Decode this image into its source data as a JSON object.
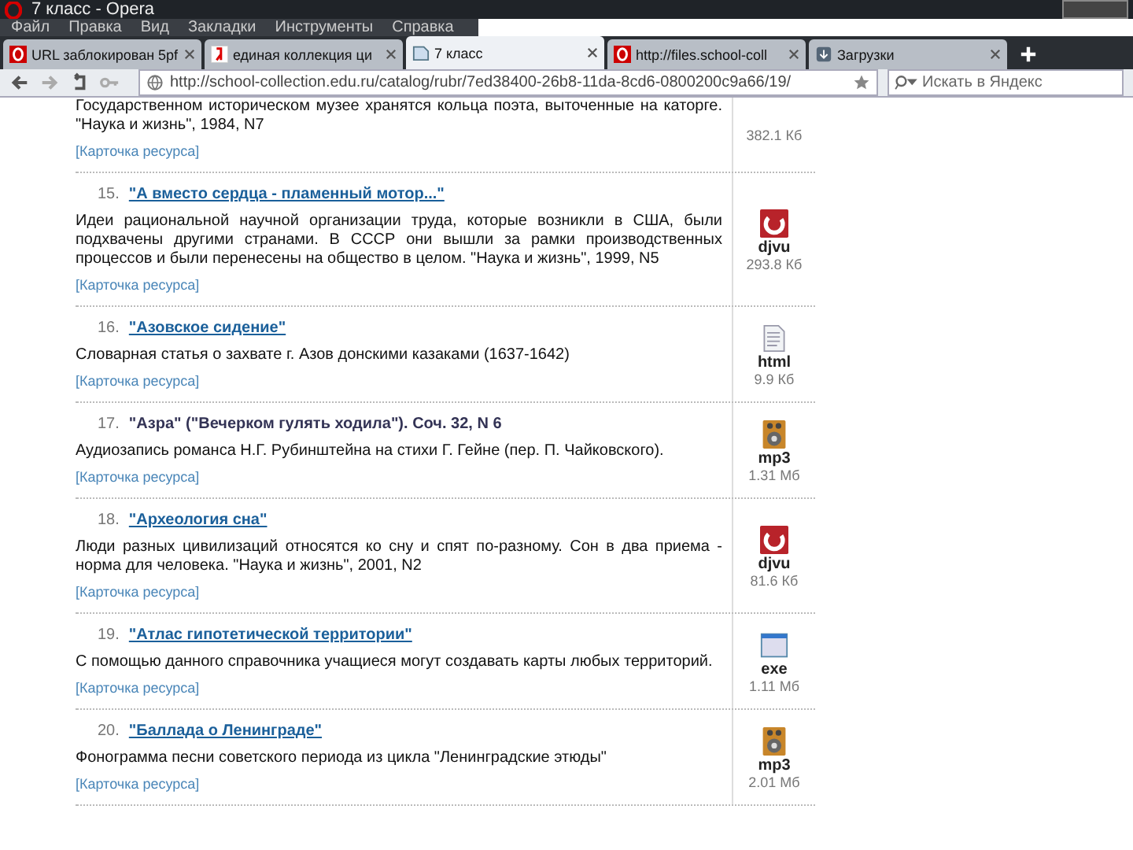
{
  "window": {
    "title": "7 класс - Opera"
  },
  "menu": [
    "Файл",
    "Правка",
    "Вид",
    "Закладки",
    "Инструменты",
    "Справка"
  ],
  "tabs": [
    {
      "label": "URL заблокирован 5pf",
      "kind": "opera",
      "selected": false
    },
    {
      "label": "единая коллекция ци",
      "kind": "yandex",
      "selected": false
    },
    {
      "label": "7 класс",
      "kind": "page",
      "selected": true
    },
    {
      "label": "http://files.school-coll",
      "kind": "opera",
      "selected": false
    },
    {
      "label": "Загрузки",
      "kind": "download",
      "selected": false
    }
  ],
  "address": {
    "value": "http://school-collection.edu.ru/catalog/rubr/7ed38400-26b8-11da-8cd6-0800200c9a66/19/"
  },
  "search": {
    "placeholder": "Искать в Яндекс"
  },
  "partial_item": {
    "description": "Государственном историческом музее хранятся кольца поэта, выточенные на каторге. \"Наука и жизнь\", 1984, N7",
    "card_link": "[Карточка ресурса]",
    "size": "382.1 Кб"
  },
  "items": [
    {
      "number": "15.",
      "title": "\"А вместо сердца - пламенный мотор...\"",
      "visited": false,
      "description": "Идеи рациональной научной организации труда, которые возникли в США, были подхвачены другими странами. В СССР они вышли за рамки производственных процессов и были перенесены на общество в целом. \"Наука и жизнь\", 1999, N5",
      "card_link": "[Карточка ресурса]",
      "kind": "djvu",
      "format": "djvu",
      "size": "293.8 Кб"
    },
    {
      "number": "16.",
      "title": "\"Азовское сидение\"",
      "visited": false,
      "description": "Словарная статья о захвате г. Азов донскими казаками (1637-1642)",
      "card_link": "[Карточка ресурса]",
      "kind": "html",
      "format": "html",
      "size": "9.9 Кб"
    },
    {
      "number": "17.",
      "title": "\"Азра\" (\"Вечерком гулять ходила\"). Соч. 32, N 6",
      "visited": true,
      "description": "Аудиозапись романса Н.Г. Рубинштейна на стихи Г. Гейне (пер. П. Чайковского).",
      "card_link": "[Карточка ресурса]",
      "kind": "mp3",
      "format": "mp3",
      "size": "1.31 Мб"
    },
    {
      "number": "18.",
      "title": "\"Археология сна\"",
      "visited": false,
      "description": "Люди разных цивилизаций относятся ко сну и спят по-разному. Сон в два приема - норма для человека. \"Наука и жизнь\", 2001, N2",
      "card_link": "[Карточка ресурса]",
      "kind": "djvu",
      "format": "djvu",
      "size": "81.6 Кб"
    },
    {
      "number": "19.",
      "title": "\"Атлас гипотетической территории\"",
      "visited": false,
      "description": "С помощью данного справочника учащиеся могут создавать карты любых территорий.",
      "card_link": "[Карточка ресурса]",
      "kind": "exe",
      "format": "exe",
      "size": "1.11 Мб"
    },
    {
      "number": "20.",
      "title": "\"Баллада о Ленинграде\"",
      "visited": false,
      "description": "Фонограмма песни советского периода из цикла \"Ленинградские этюды\"",
      "card_link": "[Карточка ресурса]",
      "kind": "mp3",
      "format": "mp3",
      "size": "2.01 Мб"
    }
  ]
}
